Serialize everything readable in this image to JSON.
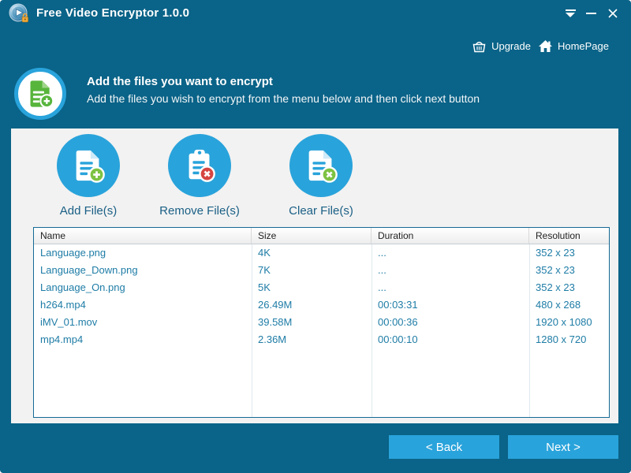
{
  "titlebar": {
    "title": "Free Video Encryptor 1.0.0"
  },
  "menu": {
    "upgrade": "Upgrade",
    "homepage": "HomePage"
  },
  "hero": {
    "title": "Add the files you want to encrypt",
    "subtitle": "Add the files you wish to encrypt from the menu below and then click next button"
  },
  "toolbar": {
    "add_label": "Add File(s)",
    "remove_label": "Remove File(s)",
    "clear_label": "Clear File(s)"
  },
  "table": {
    "columns": [
      "Name",
      "Size",
      "Duration",
      "Resolution"
    ],
    "rows": [
      {
        "name": "Language.png",
        "size": "4K",
        "duration": "...",
        "resolution": "352 x 23"
      },
      {
        "name": "Language_Down.png",
        "size": "7K",
        "duration": "...",
        "resolution": "352 x 23"
      },
      {
        "name": "Language_On.png",
        "size": "5K",
        "duration": "...",
        "resolution": "352 x 23"
      },
      {
        "name": "h264.mp4",
        "size": "26.49M",
        "duration": "00:03:31",
        "resolution": "480 x 268"
      },
      {
        "name": "iMV_01.mov",
        "size": "39.58M",
        "duration": "00:00:36",
        "resolution": "1920 x 1080"
      },
      {
        "name": "mp4.mp4",
        "size": "2.36M",
        "duration": "00:00:10",
        "resolution": "1280 x 720"
      }
    ]
  },
  "footer": {
    "back_label": "< Back",
    "next_label": "Next >"
  },
  "colors": {
    "chrome_blue": "#0A6388",
    "accent_blue": "#29A3DB",
    "content_bg": "#F2F2F2",
    "row_text": "#1E7CA6",
    "green": "#57B53C",
    "red": "#D64541",
    "lock_gold": "#F0A93C"
  }
}
